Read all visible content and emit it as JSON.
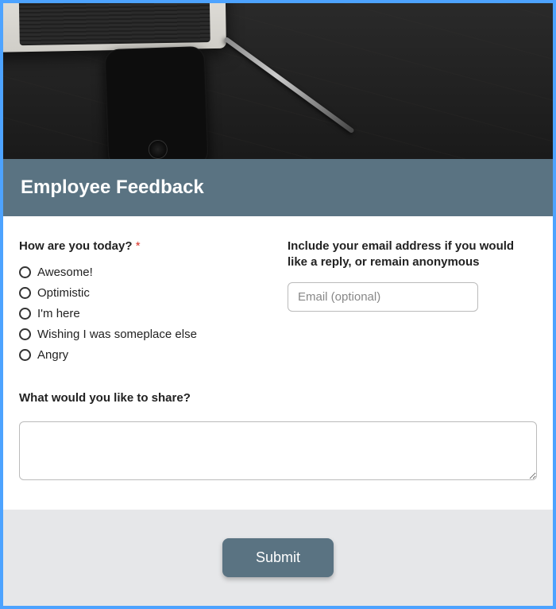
{
  "title": "Employee Feedback",
  "q1": {
    "label": "How are you today?",
    "required_marker": "*",
    "options": [
      "Awesome!",
      "Optimistic",
      "I'm here",
      "Wishing I was someplace else",
      "Angry"
    ]
  },
  "q2": {
    "label": "Include your email address if you would like a reply, or remain anonymous",
    "placeholder": "Email (optional)"
  },
  "q3": {
    "label": "What would you like to share?"
  },
  "submit_label": "Submit"
}
